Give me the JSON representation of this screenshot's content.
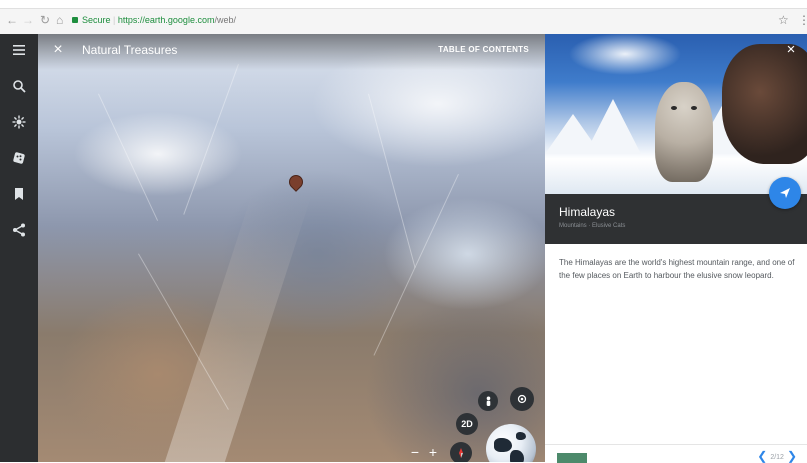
{
  "browser": {
    "back_icon": "back-arrow-icon",
    "forward_icon": "forward-arrow-icon",
    "reload_icon": "reload-icon",
    "home_icon": "home-icon",
    "secure_label": "Secure",
    "url_host": "https://earth.google.com",
    "url_path": "/web/"
  },
  "sidebar": {
    "items": [
      {
        "icon": "menu-icon"
      },
      {
        "icon": "search-icon"
      },
      {
        "icon": "voyager-icon"
      },
      {
        "icon": "feeling-lucky-icon"
      },
      {
        "icon": "bookmark-icon"
      },
      {
        "icon": "share-icon"
      }
    ]
  },
  "map": {
    "title": "Natural Treasures",
    "toc_label": "TABLE OF CONTENTS",
    "close_label": "×",
    "view_mode_label": "2D",
    "zoom_out_label": "−",
    "zoom_in_label": "+"
  },
  "panel": {
    "close_label": "×",
    "place_title": "Himalayas",
    "place_subtitle": "Mountains · Elusive Cats",
    "description": "The Himalayas are the world's highest mountain range, and one of the few places on Earth to harbour the elusive snow leopard.",
    "nav_prev_label": "❮",
    "nav_next_label": "❯",
    "nav_count": "2/12"
  },
  "colors": {
    "accent": "#2e86e8",
    "rail": "#2c2e30",
    "title_band": "#2f3133",
    "secure_green": "#1e8e3e"
  }
}
